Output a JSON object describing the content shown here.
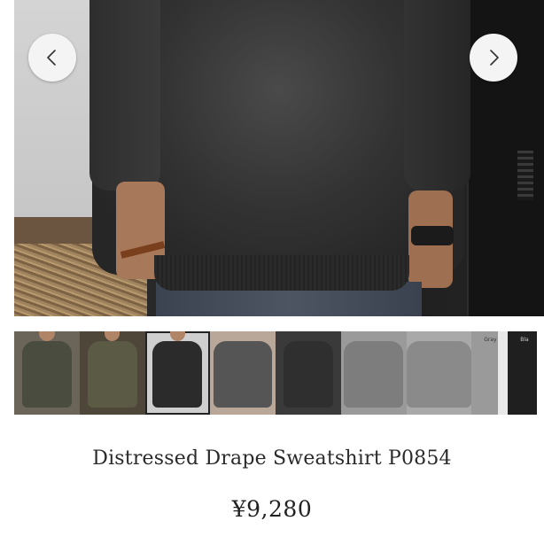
{
  "product": {
    "name": "Distressed Drape Sweatshirt P0854",
    "price": "¥9,280"
  },
  "gallery": {
    "prev_icon": "chevron-left-icon",
    "next_icon": "chevron-right-icon",
    "selected_index": 2,
    "thumbnails": [
      {
        "color": "#4a4c40"
      },
      {
        "color": "#5a5a45"
      },
      {
        "color": "#2b2b2b"
      },
      {
        "color": "#555555"
      },
      {
        "color": "#2f2f2f"
      },
      {
        "color": "#7d7d7d"
      },
      {
        "color": "#8a8a8a"
      },
      {
        "color": "#1f1f1f"
      }
    ],
    "swatch_labels": [
      "Gray",
      "Bla"
    ]
  }
}
